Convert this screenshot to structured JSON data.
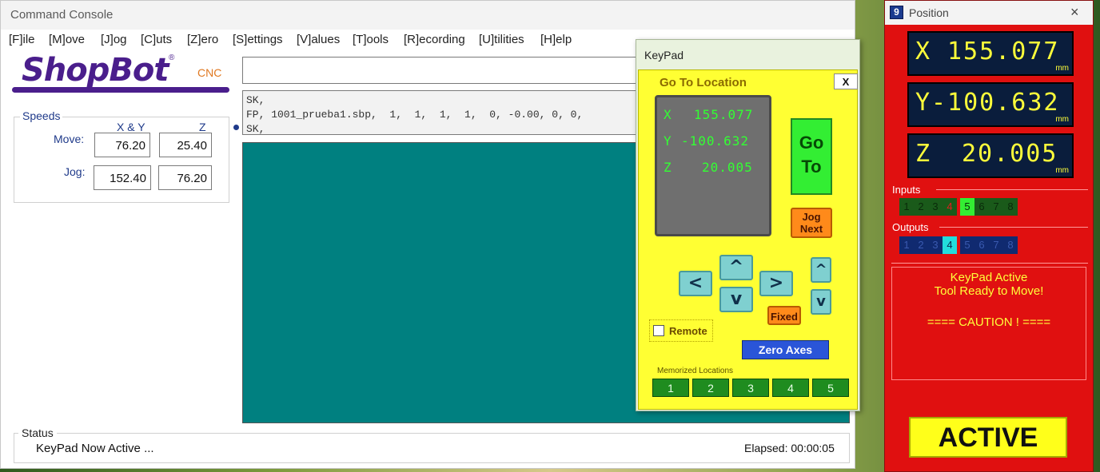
{
  "console": {
    "title": "Command Console",
    "menu": [
      "[F]ile",
      "[M]ove",
      "[J]og",
      "[C]uts",
      "[Z]ero",
      "[S]ettings",
      "[V]alues",
      "[T]ools",
      "[R]ecording",
      "[U]tilities",
      "[H]elp"
    ],
    "logo": {
      "brand": "ShopBot",
      "suffix": "CNC",
      "reg": "®"
    },
    "speeds": {
      "legend": "Speeds",
      "col_xy": "X & Y",
      "col_z": "Z",
      "move_label": "Move:",
      "jog_label": "Jog:",
      "move_xy": "76.20",
      "move_z": "25.40",
      "jog_xy": "152.40",
      "jog_z": "76.20"
    },
    "command_input": "",
    "history": "SK,\nFP, 1001_prueba1.sbp,  1,  1,  1,  1,  0, -0.00, 0, 0,\nSK,",
    "status": {
      "legend": "Status",
      "text": "KeyPad Now Active ...",
      "elapsed": "Elapsed: 00:00:05"
    }
  },
  "keypad": {
    "title": "KeyPad",
    "goto_title": "Go To Location",
    "close_label": "X",
    "mini_dro": {
      "x_label": "X",
      "x_value": "155.077",
      "y_label": "Y",
      "y_value": "-100.632",
      "z_label": "Z",
      "z_value": "20.005"
    },
    "goto_line1": "Go",
    "goto_line2": "To",
    "jog_next_line1": "Jog",
    "jog_next_line2": "Next",
    "arrow_left": "<",
    "arrow_right": ">",
    "arrow_up": "^",
    "arrow_down": "v",
    "z_up": "^",
    "z_down": "v",
    "fixed_label": "Fixed",
    "remote_label": "Remote",
    "zero_axes_label": "Zero Axes",
    "memorized_label": "Memorized Locations",
    "memorized": [
      "1",
      "2",
      "3",
      "4",
      "5"
    ]
  },
  "position": {
    "title": "Position",
    "app_icon": "9",
    "close_glyph": "×",
    "x_label": "X",
    "x_value": "155.077",
    "y_label": "Y",
    "y_value": "-100.632",
    "z_label": "Z",
    "z_value": "20.005",
    "unit": "mm",
    "inputs_label": "Inputs",
    "outputs_label": "Outputs",
    "inputs": [
      {
        "n": "1",
        "bg": "#1a5a1a",
        "fg": "#0a2a0a"
      },
      {
        "n": "2",
        "bg": "#1a5a1a",
        "fg": "#0a2a0a"
      },
      {
        "n": "3",
        "bg": "#1a5a1a",
        "fg": "#0a2a0a"
      },
      {
        "n": "4",
        "bg": "#1a5a1a",
        "fg": "#e02020"
      },
      {
        "n": "5",
        "bg": "#33ee33",
        "fg": "#0a2a0a"
      },
      {
        "n": "6",
        "bg": "#1a5a1a",
        "fg": "#0a2a0a"
      },
      {
        "n": "7",
        "bg": "#1a5a1a",
        "fg": "#0a2a0a"
      },
      {
        "n": "8",
        "bg": "#1a5a1a",
        "fg": "#0a2a0a"
      }
    ],
    "outputs": [
      {
        "n": "1",
        "bg": "#102a70",
        "fg": "#3a5ab0"
      },
      {
        "n": "2",
        "bg": "#102a70",
        "fg": "#3a5ab0"
      },
      {
        "n": "3",
        "bg": "#102a70",
        "fg": "#3a5ab0"
      },
      {
        "n": "4",
        "bg": "#22dddd",
        "fg": "#0a2a50"
      },
      {
        "n": "5",
        "bg": "#102a70",
        "fg": "#3a5ab0"
      },
      {
        "n": "6",
        "bg": "#102a70",
        "fg": "#3a5ab0"
      },
      {
        "n": "7",
        "bg": "#102a70",
        "fg": "#3a5ab0"
      },
      {
        "n": "8",
        "bg": "#102a70",
        "fg": "#3a5ab0"
      }
    ],
    "message_line1": "KeyPad Active",
    "message_line2": "Tool Ready to Move!",
    "message_line3": "==== CAUTION ! ====",
    "active_label": "ACTIVE"
  }
}
